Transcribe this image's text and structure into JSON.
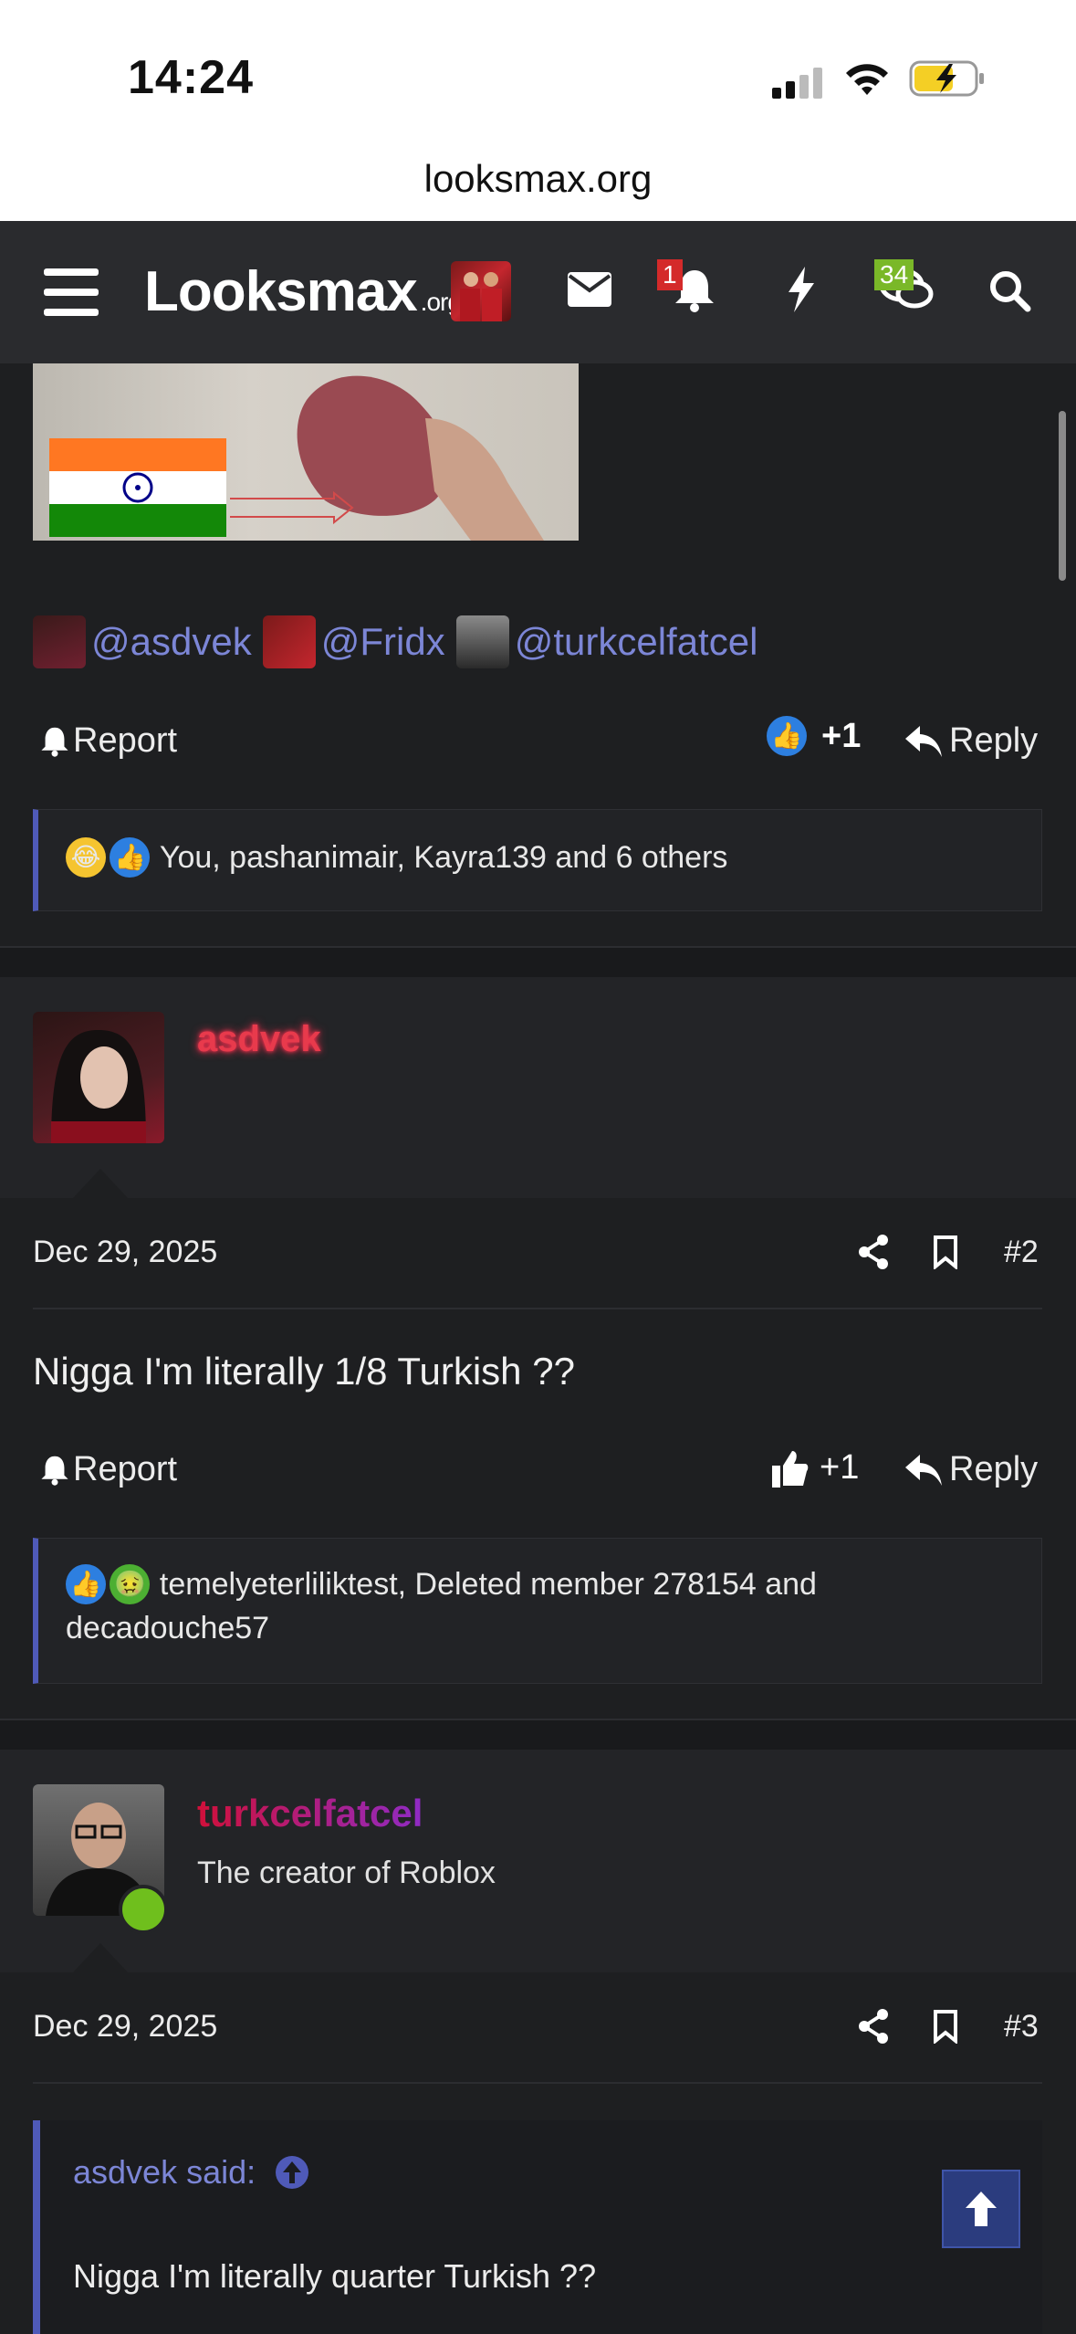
{
  "status": {
    "time": "14:24",
    "url": "looksmax.org"
  },
  "nav": {
    "logo_main": "Looksmax",
    "logo_suffix": ".org",
    "alerts_count": "1",
    "conversations_count": "34"
  },
  "post1": {
    "mentions": [
      "@asdvek",
      "@Fridx",
      "@turkcelfatcel"
    ],
    "report_label": "Report",
    "like_count": "+1",
    "reply_label": "Reply",
    "reactions_text": "You, pashanimair, Kayra139 and 6 others"
  },
  "post2": {
    "username": "asdvek",
    "date": "Dec 29, 2025",
    "post_number": "#2",
    "body": "Nigga I'm literally 1/8 Turkish ??",
    "report_label": "Report",
    "like_count": "+1",
    "reply_label": "Reply",
    "reactions_text": "temelyeterliliktest, Deleted member 278154 and decadouche57"
  },
  "post3": {
    "username": "turkcelfatcel",
    "user_title": "The creator of Roblox",
    "date": "Dec 29, 2025",
    "post_number": "#3",
    "quote_author": "asdvek said:",
    "quote_text": "Nigga I'm literally quarter Turkish ??"
  },
  "colors": {
    "accent": "#4f5ab8",
    "mention": "#7c86d6",
    "asdvek_name": "#e83a4c",
    "turkcel_name": "#b0158a",
    "online": "#6fbf1d"
  },
  "icons": [
    "hamburger-icon",
    "envelope-icon",
    "bell-icon",
    "bolt-icon",
    "chat-icon",
    "search-icon",
    "share-icon",
    "bookmark-icon",
    "reply-arrow-icon",
    "thumbs-up-icon",
    "arrow-up-icon"
  ]
}
